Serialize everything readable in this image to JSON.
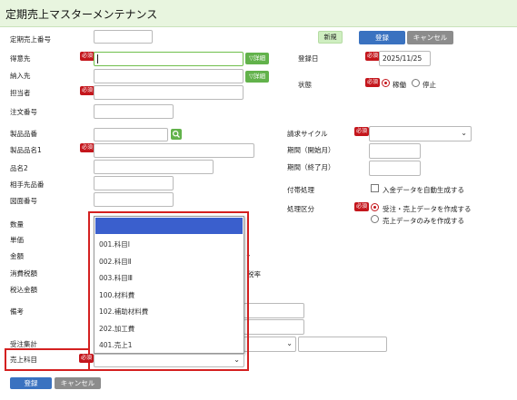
{
  "header": {
    "title": "定期売上マスターメンテナンス"
  },
  "actions": {
    "new_label": "新規",
    "register_label": "登録",
    "cancel_label": "キャンセル"
  },
  "required_label": "必須",
  "form": {
    "teiki_no_label": "定期売上番号",
    "tokuisaki_label": "得意先",
    "nonyusaki_label": "納入先",
    "tantosha_label": "担当者",
    "chumon_no_label": "注文番号",
    "detail_label": "▽詳細",
    "toroku_bi_label": "登録日",
    "toroku_bi_value": "2025/11/25",
    "status_label": "状態",
    "status_active": "稼働",
    "status_stop": "停止",
    "seihin_hinban_label": "製品品番",
    "seihin_name1_label": "製品品名1",
    "hinmei2_label": "品名2",
    "aite_hinban_label": "相手先品番",
    "zumen_no_label": "図面番号",
    "seikyu_cycle_label": "請求サイクル",
    "kikan_start_label": "期間（開始月）",
    "kikan_end_label": "期間（終了月）",
    "fuzui_label": "付帯処理",
    "auto_nyukin_label": "入金データを自動生成する",
    "shori_kubun_label": "処理区分",
    "shori_opt1": "受注・売上データを作成する",
    "shori_opt2": "売上データのみを作成する",
    "suryo_label": "数量",
    "tanka_label": "単価",
    "kingaku_label": "金額",
    "shohizei_label": "消費税額",
    "zeikomi_label": "税込金額",
    "biko_label": "備考",
    "juchu_shukei_label": "受注集計",
    "uriage_kamoku_label": "売上科目",
    "partial_zeiritsu": "税率"
  },
  "dropdown": {
    "options": [
      "001.科目Ⅰ",
      "002.科目Ⅱ",
      "003.科目Ⅲ",
      "100.材料費",
      "102.補助材料費",
      "202.加工費",
      "401.売上1"
    ]
  },
  "footer": {
    "register_label": "登録",
    "cancel_label": "キャンセル"
  },
  "colors": {
    "header_bg": "#e8f5df",
    "required": "#c4161c",
    "primary": "#3a72c0",
    "highlight": "#d42020",
    "selected": "#3a5fcd"
  }
}
